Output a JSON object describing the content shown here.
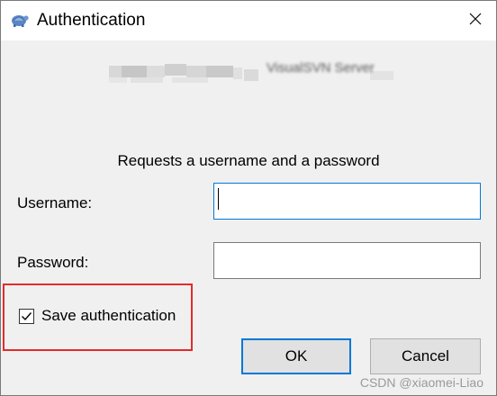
{
  "window": {
    "title": "Authentication",
    "app_icon": "tortoise-icon",
    "close_icon": "close-icon"
  },
  "server": {
    "text": "VisualSVN Server"
  },
  "prompt": "Requests a username and a password",
  "form": {
    "username_label": "Username:",
    "username_value": "",
    "password_label": "Password:",
    "password_value": "",
    "save_auth_label": "Save authentication",
    "save_auth_checked": true
  },
  "buttons": {
    "ok": "OK",
    "cancel": "Cancel"
  },
  "watermark": "CSDN @xiaomei-Liao",
  "colors": {
    "focus_border": "#0078d7",
    "highlight_border": "#e32b2b",
    "dialog_bg": "#f0f0f0"
  }
}
